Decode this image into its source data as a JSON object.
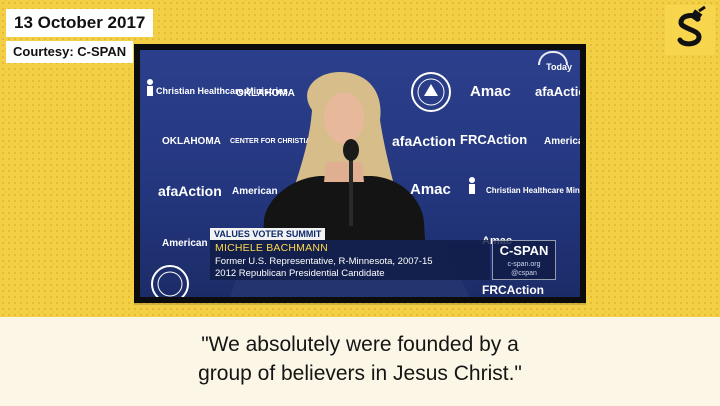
{
  "date": "13 October 2017",
  "courtesy": "Courtesy: C-SPAN",
  "video": {
    "today_badge": "Today",
    "backdrop_logos": [
      "Christian Healthcare Ministries",
      "OKLAHOMA",
      "Amac",
      "afaAction",
      "FRCAction",
      "American",
      "CENTER FOR CHRISTIAN STATESMANSHIP"
    ],
    "lower_third": {
      "event": "VALUES VOTER SUMMIT",
      "name": "MICHELE BACHMANN",
      "line1": "Former U.S. Representative, R-Minnesota, 2007-15",
      "line2": "2012 Republican Presidential Candidate",
      "network_logo": "C-SPAN",
      "network_url": "c-span.org",
      "network_handle": "@cspan"
    }
  },
  "quote": {
    "line1": "\"We absolutely were founded by a",
    "line2": "group of believers in Jesus Christ.\""
  },
  "colors": {
    "background": "#f2cf45",
    "quote_band": "#fbf6e6",
    "frame": "#0c0c0c",
    "screen_blue": "#2c3f8c",
    "name_yellow": "#ffd84a"
  },
  "icons": {
    "brand_logo": "s-logo-icon",
    "logo_medallion": "medallion-icon"
  }
}
